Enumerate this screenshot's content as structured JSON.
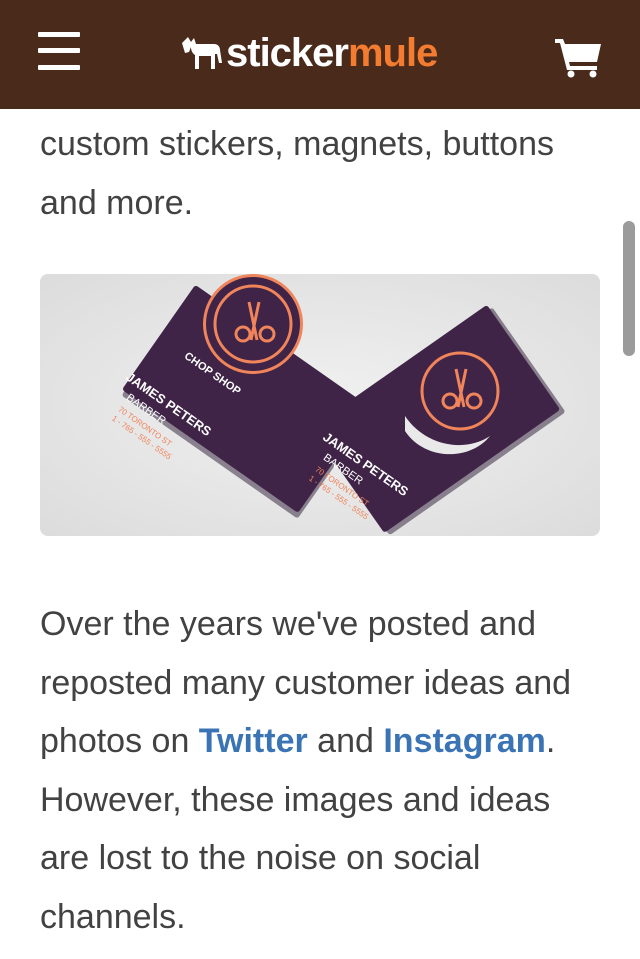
{
  "header": {
    "menu_icon": "hamburger-menu-icon",
    "logo_icon": "mule-icon",
    "logo_part1": "sticker",
    "logo_part2": "mule",
    "cart_icon": "shopping-cart-icon",
    "colors": {
      "background": "#4a2a1a",
      "accent": "#f47c30"
    }
  },
  "article": {
    "intro_text": "custom stickers, magnets, buttons and more.",
    "photo": {
      "brand_label": "CHOP SHOP",
      "name": "JAMES PETERS",
      "title": "BARBER",
      "address": "70 TORONTO ST",
      "phone": "1 - 765 - 555 - 5555"
    },
    "paragraph": {
      "before_twitter": "Over the years we've posted and reposted many customer ideas and photos on ",
      "twitter_link": "Twitter",
      "between_links": " and ",
      "instagram_link": "Instagram",
      "after_instagram": ". However, these images and ideas are lost to the noise on social channels."
    },
    "link_color": "#3b74b5"
  }
}
